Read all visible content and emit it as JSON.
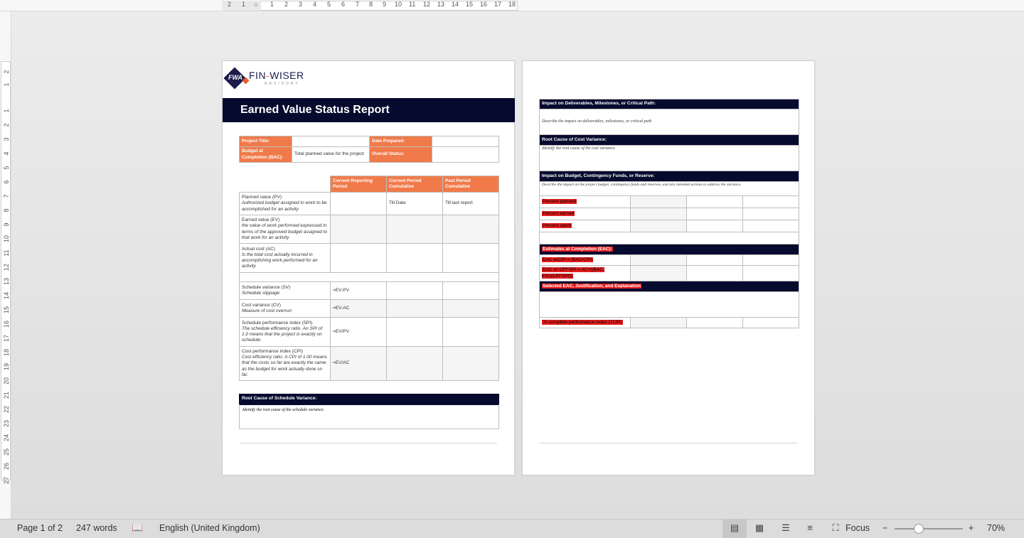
{
  "ruler": {
    "h_numbers": [
      "2",
      "1",
      "1",
      "2",
      "3",
      "4",
      "5",
      "6",
      "7",
      "8",
      "9",
      "10",
      "11",
      "12",
      "13",
      "14",
      "15",
      "16",
      "17",
      "18"
    ],
    "v_numbers": [
      "2",
      "1",
      "1",
      "2",
      "3",
      "4",
      "5",
      "6",
      "7",
      "8",
      "9",
      "10",
      "11",
      "12",
      "13",
      "14",
      "15",
      "16",
      "17",
      "18",
      "19",
      "20",
      "21",
      "22",
      "23",
      "24",
      "25",
      "26",
      "27"
    ],
    "corner_glyph": "↱"
  },
  "page1": {
    "logo": {
      "mono": "FWA",
      "brand_a": "FIN",
      "brand_dash": "-",
      "brand_b": "WISER",
      "sub": "ADVISORY"
    },
    "title": "Earned Value Status Report",
    "info": {
      "project_title_label": "Project Title:",
      "project_title_value": "",
      "date_prepared_label": "Date Prepared:",
      "date_prepared_value": "",
      "bac_label": "Budget at Completion (BAC):",
      "bac_value": "Total planned value for the project",
      "overall_status_label": "Overall Status:",
      "overall_status_value": ""
    },
    "metrics": {
      "headers": [
        "Current Reporting Period",
        "Current Period Cumulative",
        "Past Period Cumulative"
      ],
      "pv": {
        "name": "Planned value (PV)",
        "desc": "Authorized budget assigned to work to be accomplished for an activity",
        "c2": "Till Date",
        "c3": "Till last report"
      },
      "ev": {
        "name": "Earned value (EV)",
        "desc": "the value of work performed expressed in terms of the approved budget assigned to that work for an activity"
      },
      "ac": {
        "name": "Actual cost (AC)",
        "desc": "Is the total cost actually incurred in accomplishing work performed for an activity"
      },
      "sv": {
        "name": "Schedule variance (SV)",
        "desc": "Schedule slippage",
        "formula": "=EV-PV"
      },
      "cv": {
        "name": "Cost variance (CV)",
        "desc": "Measure of cost overrun",
        "formula": "=EV-AC"
      },
      "spi": {
        "name": "Schedule performance index (SPI)",
        "desc": "The schedule efficiency ratio. An SPI of 1.0 means that the project is exactly on schedule.",
        "formula": "=EV/PV"
      },
      "cpi": {
        "name": "Cost performance index (CPI)",
        "desc": "Cost efficiency ratio. A CPI of 1.00 means that the costs so far are exactly the same as the budget for work actually done so far.",
        "formula": "=EV/AC"
      }
    },
    "root_schedule": {
      "heading": "Root Cause of Schedule Variance:",
      "text": "Identify the root cause of the schedule variance."
    }
  },
  "page2": {
    "impact_deliverables": {
      "heading": "Impact on Deliverables, Milestones, or Critical Path:",
      "text": "Describe the impact on deliverables, milestones, or critical path"
    },
    "root_cost": {
      "heading": "Root Cause of Cost Variance:",
      "text": "Identify the root cause of the cost variance."
    },
    "impact_budget": {
      "heading": "Impact on Budget, Contingency Funds, or Reserve:",
      "text": "Describe the impact on the project budget, contingency funds and reserves, and any intended actions to address the variance."
    },
    "percent_rows": [
      "Percent planned",
      "Percent earned",
      "Percent spent"
    ],
    "eac": {
      "heading": "Estimates at Completion (EAC):",
      "row1": "EAC w/CPI = (BAC/CPI)",
      "row2": "EAC w/ CPI*SPI = AC+((BAC-EV)/(CPI*SPI))"
    },
    "selected_eac": {
      "heading": "Selected EAC, Justification, and Explanation"
    },
    "tcpi": "To complete performance index (TCPI)"
  },
  "status": {
    "page": "Page 1 of 2",
    "words": "247 words",
    "language": "English (United Kingdom)",
    "focus": "Focus",
    "zoom": "70%",
    "zoom_minus": "−",
    "zoom_plus": "+"
  },
  "colors": {
    "navy": "#050a2e",
    "orange": "#f07a4a",
    "highlight_red": "#e61e1e"
  }
}
